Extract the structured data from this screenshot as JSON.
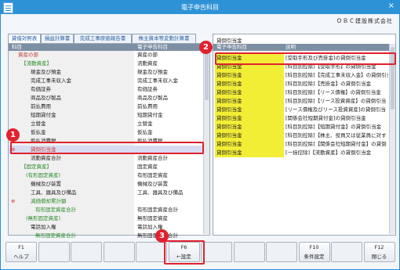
{
  "window": {
    "title": "電子申告科目",
    "company": "ＯＢＣ建設株式会社",
    "close": "×"
  },
  "tabs": [
    "貸借対照表",
    "損益計算書",
    "完成工事原価報告書",
    "株主資本等変動計算書"
  ],
  "left_table": {
    "headers": [
      "科目",
      "電子申告科目"
    ],
    "rows": [
      {
        "name": "資産の部",
        "code": "資産の部"
      },
      {
        "name": "【流動資産】",
        "code": "流動資産"
      },
      {
        "name": "現金及び預金",
        "code": "現金及び預金"
      },
      {
        "name": "完成工事未収入金",
        "code": "完成工事未収入金"
      },
      {
        "name": "有価証券",
        "code": "有価証券"
      },
      {
        "name": "商品及び製品",
        "code": "商品及び製品"
      },
      {
        "name": "前払費用",
        "code": "前払費用"
      },
      {
        "name": "短期貸付金",
        "code": "短期貸付金"
      },
      {
        "name": "立替金",
        "code": "立替金"
      },
      {
        "name": "仮払金",
        "code": "仮払金"
      },
      {
        "name": "仮払消費税",
        "code": "仮払消費税"
      },
      {
        "name": "貸倒引当金",
        "code": "",
        "mark": "⊕"
      },
      {
        "name": "流動資産合計",
        "code": "流動資産合計"
      },
      {
        "name": "【固定資産】",
        "code": "固定資産"
      },
      {
        "name": "(有形固定資産)",
        "code": "有形固定資産"
      },
      {
        "name": "機械及び装置",
        "code": "機械及び装置"
      },
      {
        "name": "工具、器具及び備品",
        "code": "工具、器具及び備品"
      },
      {
        "name": "減価償却累計額",
        "code": "",
        "mark": "⊕"
      },
      {
        "name": "有形固定資産合計",
        "code": "有形固定資産合計"
      },
      {
        "name": "(無形固定資産)",
        "code": "無形固定資産"
      },
      {
        "name": "電話加入権",
        "code": "電話加入権"
      },
      {
        "name": "無形固定資産合計",
        "code": "無形固定資産合計"
      }
    ]
  },
  "right_panel": {
    "heading": "貸倒引当金",
    "headers": [
      "電子申告科目",
      "説明"
    ],
    "rows": [
      {
        "name": "貸倒引当金",
        "desc": "[受取手形及び売掛金]の貸倒引当金"
      },
      {
        "name": "貸倒引当金",
        "desc": "[科目別控除]【受取手形】の貸倒引当金"
      },
      {
        "name": "貸倒引当金",
        "desc": "[科目別控除]【完成工事未収入金】の貸倒引当"
      },
      {
        "name": "貸倒引当金",
        "desc": "[科目別控除]【売掛金】の貸倒引当金"
      },
      {
        "name": "貸倒引当金",
        "desc": "[科目別控除]【リース債権】の貸倒引当金"
      },
      {
        "name": "貸倒引当金",
        "desc": "[科目別控除]【リース投資資産】の貸倒引当"
      },
      {
        "name": "貸倒引当金",
        "desc": "[リース債権及びリース投資資産]の貸倒引当"
      },
      {
        "name": "貸倒引当金",
        "desc": "[関係会社短期貸付金]の貸倒引当金"
      },
      {
        "name": "貸倒引当金",
        "desc": "[科目別控除]【短期貸付金】の貸倒引当金"
      },
      {
        "name": "貸倒引当金",
        "desc": "[科目別控除]【株主、役員又は従業員に対す"
      },
      {
        "name": "貸倒引当金",
        "desc": "[科目別控除]【関係会社短期貸付金】の貸倒"
      },
      {
        "name": "貸倒引当金",
        "desc": "[一括控除]【流動資産】の貸倒引当金"
      }
    ]
  },
  "badges": [
    "1",
    "2",
    "3"
  ],
  "fkeys": [
    {
      "key": "F1",
      "label": "ヘルプ"
    },
    {
      "key": "",
      "label": ""
    },
    {
      "key": "",
      "label": ""
    },
    {
      "key": "",
      "label": ""
    },
    {
      "key": "",
      "label": ""
    },
    {
      "key": "F6",
      "label": "←設定"
    },
    {
      "key": "",
      "label": ""
    },
    {
      "key": "",
      "label": ""
    },
    {
      "key": "",
      "label": ""
    },
    {
      "key": "F10",
      "label": "条件設定"
    },
    {
      "key": "",
      "label": ""
    },
    {
      "key": "F12",
      "label": "閉じる"
    }
  ]
}
